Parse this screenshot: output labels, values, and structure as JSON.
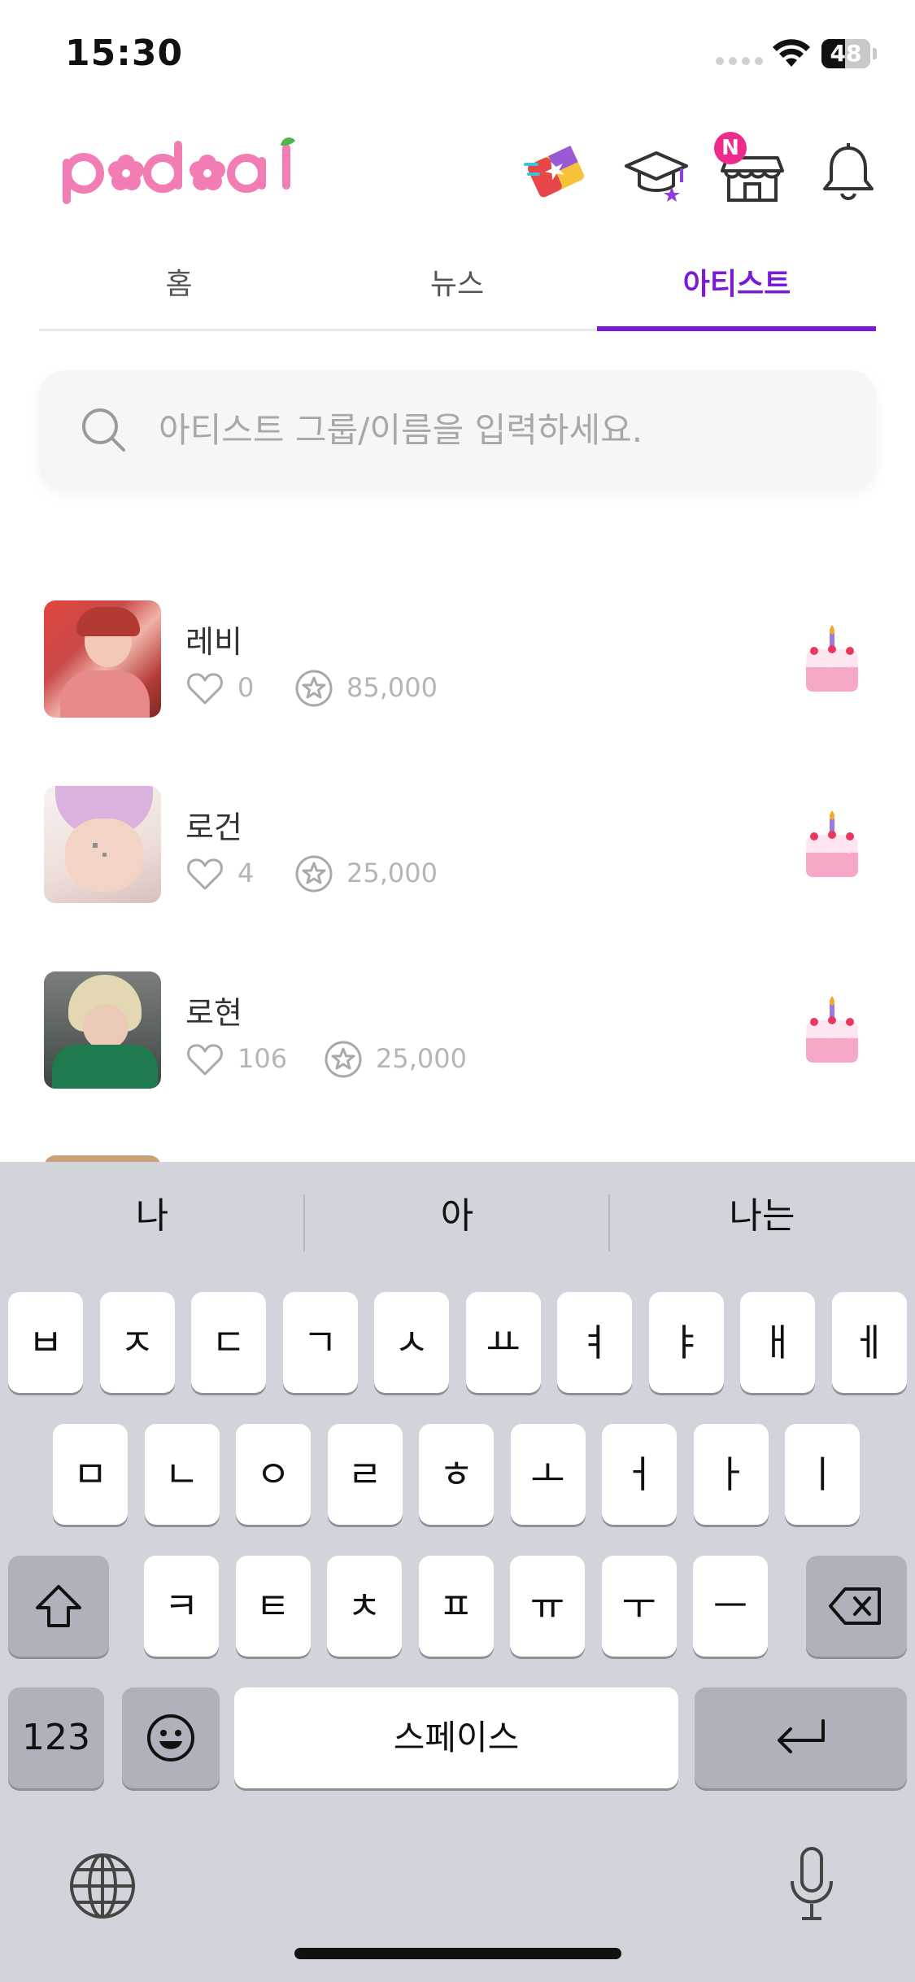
{
  "status_bar": {
    "time": "15:30",
    "battery": "48"
  },
  "header": {
    "logo_text": "podoal",
    "shop_badge": "N"
  },
  "tabs": [
    {
      "label": "홈",
      "active": false
    },
    {
      "label": "뉴스",
      "active": false
    },
    {
      "label": "아티스트",
      "active": true
    }
  ],
  "search": {
    "placeholder": "아티스트 그룹/이름을 입력하세요.",
    "value": ""
  },
  "artists": [
    {
      "name": "레비",
      "likes": "0",
      "stars": "85,000"
    },
    {
      "name": "로건",
      "likes": "4",
      "stars": "25,000"
    },
    {
      "name": "로현",
      "likes": "106",
      "stars": "25,000"
    }
  ],
  "keyboard": {
    "suggestions": [
      "나",
      "아",
      "나는"
    ],
    "row1": [
      "ㅂ",
      "ㅈ",
      "ㄷ",
      "ㄱ",
      "ㅅ",
      "ㅛ",
      "ㅕ",
      "ㅑ",
      "ㅐ",
      "ㅔ"
    ],
    "row2": [
      "ㅁ",
      "ㄴ",
      "ㅇ",
      "ㄹ",
      "ㅎ",
      "ㅗ",
      "ㅓ",
      "ㅏ",
      "ㅣ"
    ],
    "row3": [
      "ㅋ",
      "ㅌ",
      "ㅊ",
      "ㅍ",
      "ㅠ",
      "ㅜ",
      "ㅡ"
    ],
    "numbers_label": "123",
    "space_label": "스페이스"
  },
  "colors": {
    "accent": "#7a19d6",
    "badge": "#ee2b8c",
    "logo": "#f27db4"
  }
}
